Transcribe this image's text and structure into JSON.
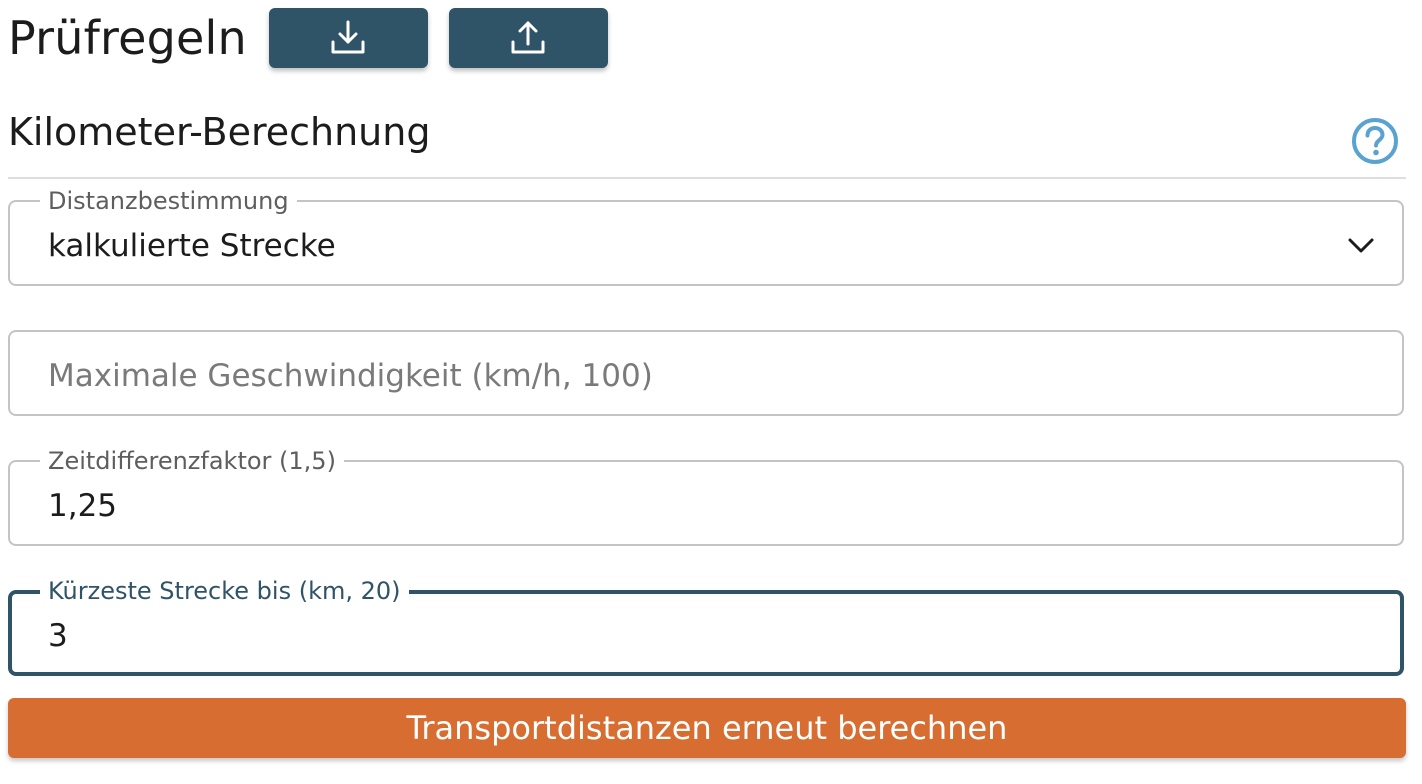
{
  "header": {
    "title": "Prüfregeln",
    "download_icon": "download-icon",
    "upload_icon": "upload-icon"
  },
  "section": {
    "title": "Kilometer-Berechnung",
    "help_icon": "help-icon"
  },
  "form": {
    "distance_mode": {
      "label": "Distanzbestimmung",
      "value": "kalkulierte Strecke"
    },
    "max_speed": {
      "placeholder": "Maximale Geschwindigkeit (km/h, 100)",
      "value": ""
    },
    "time_diff_factor": {
      "label": "Zeitdifferenzfaktor (1,5)",
      "value": "1,25"
    },
    "shortest_route": {
      "label": "Kürzeste Strecke bis (km, 20)",
      "value": "3"
    }
  },
  "actions": {
    "recalculate_label": "Transportdistanzen erneut berechnen"
  },
  "colors": {
    "primary": "#2f5468",
    "accent": "#d86d32",
    "help": "#5aa3d0"
  }
}
